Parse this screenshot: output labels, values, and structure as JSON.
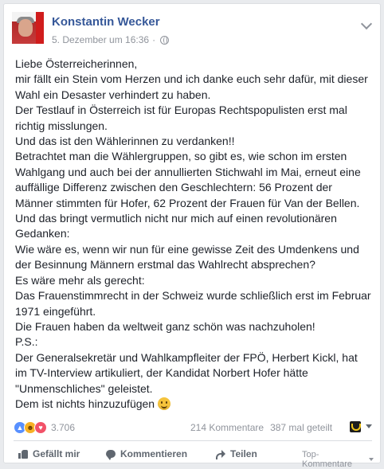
{
  "post": {
    "author": "Konstantin Wecker",
    "timestamp": "5. Dezember um 16:36",
    "separator": "·",
    "paragraphs": [
      "Liebe Österreicherinnen,",
      "mir fällt ein Stein vom Herzen und ich danke euch sehr dafür, mit dieser Wahl ein Desaster verhindert zu haben.",
      "Der Testlauf in Österreich ist für Europas Rechtspopulisten erst mal richtig misslungen.",
      "Und das ist den Wählerinnen zu verdanken!!",
      "Betrachtet man die Wählergruppen, so gibt es, wie schon im ersten Wahlgang und auch bei der annullierten Stichwahl im Mai, erneut eine auffällige Differenz zwischen den Geschlechtern: 56 Prozent der Männer stimmten für Hofer, 62 Prozent der Frauen für Van der Bellen.",
      "Und das bringt vermutlich nicht nur mich auf einen revolutionären Gedanken:",
      "Wie wäre es, wenn wir nun für eine gewisse Zeit des Umdenkens und der Besinnung Männern erstmal das Wahlrecht absprechen?",
      "Es wäre mehr als gerecht:",
      "Das Frauenstimmrecht in der Schweiz wurde schließlich erst im Februar 1971 eingeführt.",
      "Die Frauen haben da weltweit ganz schön was nachzuholen!",
      "P.S.:",
      "Der Generalsekretär und Wahlkampfleiter der FPÖ, Herbert Kickl, hat im TV-Interview artikuliert, der Kandidat Norbert Hofer hätte \"Unmenschliches\" geleistet."
    ],
    "last_line": "Dem ist nichts hinzuzufügen"
  },
  "stats": {
    "reaction_count": "3.706",
    "comments": "214 Kommentare",
    "shares": "387 mal geteilt"
  },
  "actions": {
    "like": "Gefällt mir",
    "comment": "Kommentieren",
    "share": "Teilen",
    "sort": "Top-Kommentare"
  },
  "icons": {
    "reactions": [
      "like-reaction-icon",
      "haha-reaction-icon",
      "love-reaction-icon"
    ],
    "menu": "chevron-down-icon",
    "privacy": "globe-icon"
  },
  "colors": {
    "name_link": "#365899",
    "muted": "#90949c",
    "text": "#1d2129"
  }
}
